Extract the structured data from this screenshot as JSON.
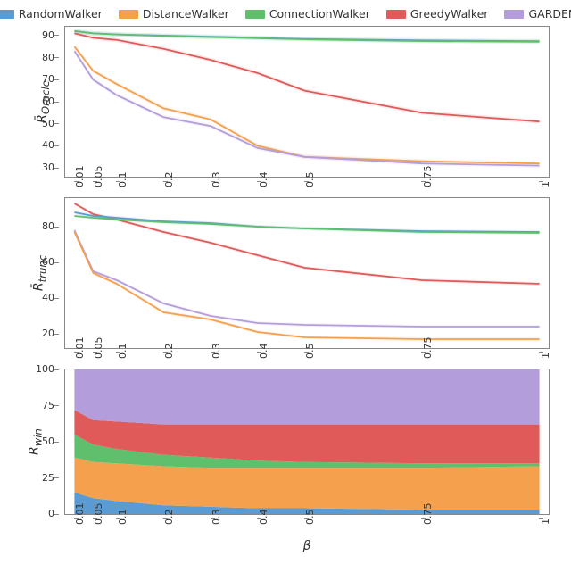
{
  "legend": {
    "items": [
      {
        "name": "RandomWalker",
        "color": "#5a9bd4"
      },
      {
        "name": "DistanceWalker",
        "color": "#f4a04c"
      },
      {
        "name": "ConnectionWalker",
        "color": "#5fbf6c"
      },
      {
        "name": "GreedyWalker",
        "color": "#e05a5a"
      },
      {
        "name": "GARDEN",
        "color": "#b39ddb"
      }
    ]
  },
  "axes": {
    "x": {
      "label": "β",
      "ticks": [
        0.01,
        0.05,
        0.1,
        0.2,
        0.3,
        0.4,
        0.5,
        0.75,
        1.0
      ],
      "min": 0.01,
      "max": 1.0
    }
  },
  "chart_data": [
    {
      "id": "oracle",
      "type": "line",
      "ylabel_html": "R̄<sub>Oracle</sub>",
      "ylim": [
        26,
        94
      ],
      "yticks": [
        30,
        40,
        50,
        60,
        70,
        80,
        90
      ],
      "series": [
        {
          "name": "RandomWalker",
          "color": "#5a9bd4",
          "values": [
            92,
            91,
            90.5,
            90,
            89.5,
            89,
            88.5,
            87.8,
            87.5
          ]
        },
        {
          "name": "ConnectionWalker",
          "color": "#5fbf6c",
          "values": [
            92,
            91,
            90.5,
            89.8,
            89.3,
            88.8,
            88.3,
            87.5,
            87.2
          ]
        },
        {
          "name": "GreedyWalker",
          "color": "#e05a5a",
          "values": [
            91,
            89,
            88,
            84,
            79,
            73,
            65,
            55,
            51
          ]
        },
        {
          "name": "DistanceWalker",
          "color": "#f4a04c",
          "values": [
            85,
            74,
            68,
            57,
            52,
            40,
            35,
            33,
            32
          ]
        },
        {
          "name": "GARDEN",
          "color": "#b39ddb",
          "values": [
            83,
            70,
            63,
            53,
            49,
            39,
            35,
            32,
            31
          ]
        }
      ]
    },
    {
      "id": "trunc",
      "type": "line",
      "ylabel_html": "R̄<sub>trunc</sub>",
      "ylim": [
        12,
        96
      ],
      "yticks": [
        20,
        40,
        60,
        80
      ],
      "series": [
        {
          "name": "GreedyWalker",
          "color": "#e05a5a",
          "values": [
            93,
            87,
            84,
            77,
            71,
            64,
            57,
            50,
            48
          ]
        },
        {
          "name": "RandomWalker",
          "color": "#5a9bd4",
          "values": [
            88,
            86,
            85,
            83,
            82,
            80,
            79,
            77.5,
            77
          ]
        },
        {
          "name": "ConnectionWalker",
          "color": "#5fbf6c",
          "values": [
            86,
            85,
            84,
            82.5,
            81.5,
            80,
            79,
            77,
            76.5
          ]
        },
        {
          "name": "GARDEN",
          "color": "#b39ddb",
          "values": [
            78,
            55,
            50,
            37,
            30,
            26,
            25,
            24,
            24
          ]
        },
        {
          "name": "DistanceWalker",
          "color": "#f4a04c",
          "values": [
            77,
            54,
            48,
            32,
            28,
            21,
            18,
            17,
            17
          ]
        }
      ]
    },
    {
      "id": "win",
      "type": "area",
      "ylabel_html": "R<sub>win</sub>",
      "ylim": [
        0,
        100
      ],
      "yticks": [
        0,
        25,
        50,
        75,
        100
      ],
      "stack_order": [
        "RandomWalker",
        "DistanceWalker",
        "ConnectionWalker",
        "GreedyWalker",
        "GARDEN"
      ],
      "series": [
        {
          "name": "RandomWalker",
          "color": "#5a9bd4",
          "values": [
            15,
            11,
            9,
            6,
            5,
            4,
            4,
            3,
            3
          ]
        },
        {
          "name": "DistanceWalker",
          "color": "#f4a04c",
          "values": [
            24,
            25,
            26,
            27,
            27,
            28,
            28,
            29,
            30
          ]
        },
        {
          "name": "ConnectionWalker",
          "color": "#5fbf6c",
          "values": [
            16,
            12,
            10,
            8,
            7,
            5,
            4,
            3,
            2
          ]
        },
        {
          "name": "GreedyWalker",
          "color": "#e05a5a",
          "values": [
            17,
            17,
            19,
            21,
            23,
            25,
            26,
            27,
            27
          ]
        },
        {
          "name": "GARDEN",
          "color": "#b39ddb",
          "values": [
            28,
            35,
            36,
            38,
            38,
            38,
            38,
            38,
            38
          ]
        }
      ]
    }
  ]
}
